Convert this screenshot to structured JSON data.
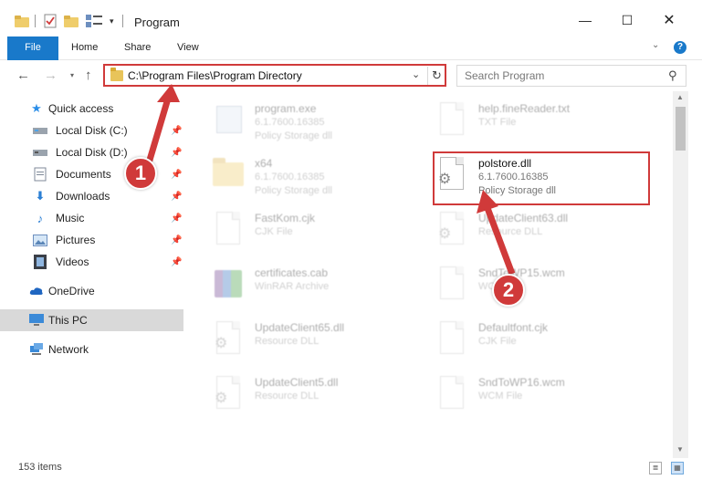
{
  "window": {
    "title": "Program",
    "minimize": "—",
    "maximize": "☐",
    "close": "✕"
  },
  "ribbon": {
    "tabs": [
      "File",
      "Home",
      "Share",
      "View"
    ],
    "expand": "⌄",
    "help": "?"
  },
  "address": {
    "path": "C:\\Program Files\\Program Directory",
    "refresh": "↻"
  },
  "search": {
    "placeholder": "Search Program"
  },
  "sidebar": {
    "items": [
      {
        "label": "Quick access",
        "icon": "star-icon"
      },
      {
        "label": "Local Disk (C:)",
        "icon": "drive-icon"
      },
      {
        "label": "Local Disk (D:)",
        "icon": "drive-icon"
      },
      {
        "label": "Documents",
        "icon": "documents-icon"
      },
      {
        "label": "Downloads",
        "icon": "download-icon"
      },
      {
        "label": "Music",
        "icon": "music-icon"
      },
      {
        "label": "Pictures",
        "icon": "pictures-icon"
      },
      {
        "label": "Videos",
        "icon": "videos-icon"
      },
      {
        "label": "OneDrive",
        "icon": "cloud-icon"
      },
      {
        "label": "This PC",
        "icon": "computer-icon"
      },
      {
        "label": "Network",
        "icon": "network-icon"
      }
    ]
  },
  "files": [
    {
      "name": "program.exe",
      "meta1": "6.1.7600.16385",
      "meta2": "Policy Storage dll"
    },
    {
      "name": "help.fineReader.txt",
      "meta1": "TXT File",
      "meta2": ""
    },
    {
      "name": "x64",
      "meta1": "6.1.7600.16385",
      "meta2": "Policy Storage dll"
    },
    {
      "name": "polstore.dll",
      "meta1": "6.1.7600.16385",
      "meta2": "Policy Storage dll"
    },
    {
      "name": "FastKom.cjk",
      "meta1": "CJK File",
      "meta2": ""
    },
    {
      "name": "UpdateClient63.dll",
      "meta1": "Resource DLL",
      "meta2": ""
    },
    {
      "name": "certificates.cab",
      "meta1": "WinRAR Archive",
      "meta2": ""
    },
    {
      "name": "SndToWP15.wcm",
      "meta1": "WCM File",
      "meta2": ""
    },
    {
      "name": "UpdateClient65.dll",
      "meta1": "Resource DLL",
      "meta2": ""
    },
    {
      "name": "Defaultfont.cjk",
      "meta1": "CJK File",
      "meta2": ""
    },
    {
      "name": "UpdateClient5.dll",
      "meta1": "Resource DLL",
      "meta2": ""
    },
    {
      "name": "SndToWP16.wcm",
      "meta1": "WCM File",
      "meta2": ""
    }
  ],
  "status": {
    "count": "153 items"
  },
  "callouts": {
    "one": "1",
    "two": "2"
  },
  "colors": {
    "accent": "#1979ca",
    "highlight": "#d03a3a"
  }
}
